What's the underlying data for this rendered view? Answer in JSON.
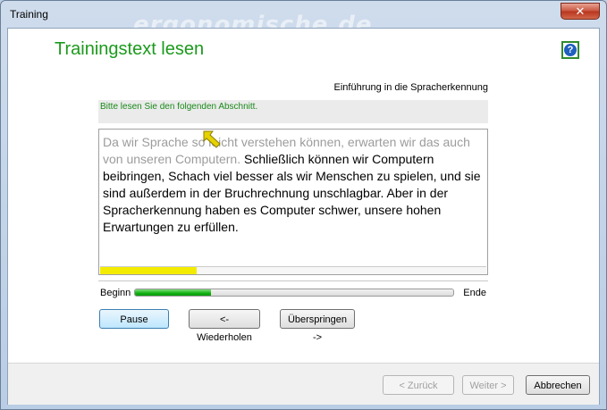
{
  "window": {
    "title": "Training",
    "watermark": "ergonomische.de",
    "close_symbol": "✕"
  },
  "page": {
    "heading": "Trainingstext lesen",
    "help_symbol": "?",
    "section_title": "Einführung in die Spracherkennung",
    "instruction": "Bitte lesen Sie den folgenden Abschnitt."
  },
  "reading": {
    "read_text": "Da wir Sprache so leicht verstehen können, erwarten wir das auch von unseren Computern.",
    "unread_text": " Schließlich können wir Computern beibringen, Schach viel besser als wir Menschen zu spielen, und sie sind außerdem in der Bruchrechnung unschlagbar. Aber in der Spracherkennung haben es Computer schwer, unsere hohen Erwartungen zu erfüllen.",
    "text_progress": 0.25,
    "marker_icon": "yellow-arrow-icon"
  },
  "progress": {
    "begin_label": "Beginn",
    "end_label": "Ende",
    "value": 0.24
  },
  "controls": {
    "pause_label": "Pause",
    "repeat_label": "<- Wiederholen",
    "skip_label": "Überspringen ->"
  },
  "footer": {
    "back_label": "< Zurück",
    "next_label": "Weiter >",
    "cancel_label": "Abbrechen"
  },
  "colors": {
    "heading": "#1c9a1c",
    "progress_fill": "#12b012",
    "text_progress_fill": "#f4ec00"
  }
}
